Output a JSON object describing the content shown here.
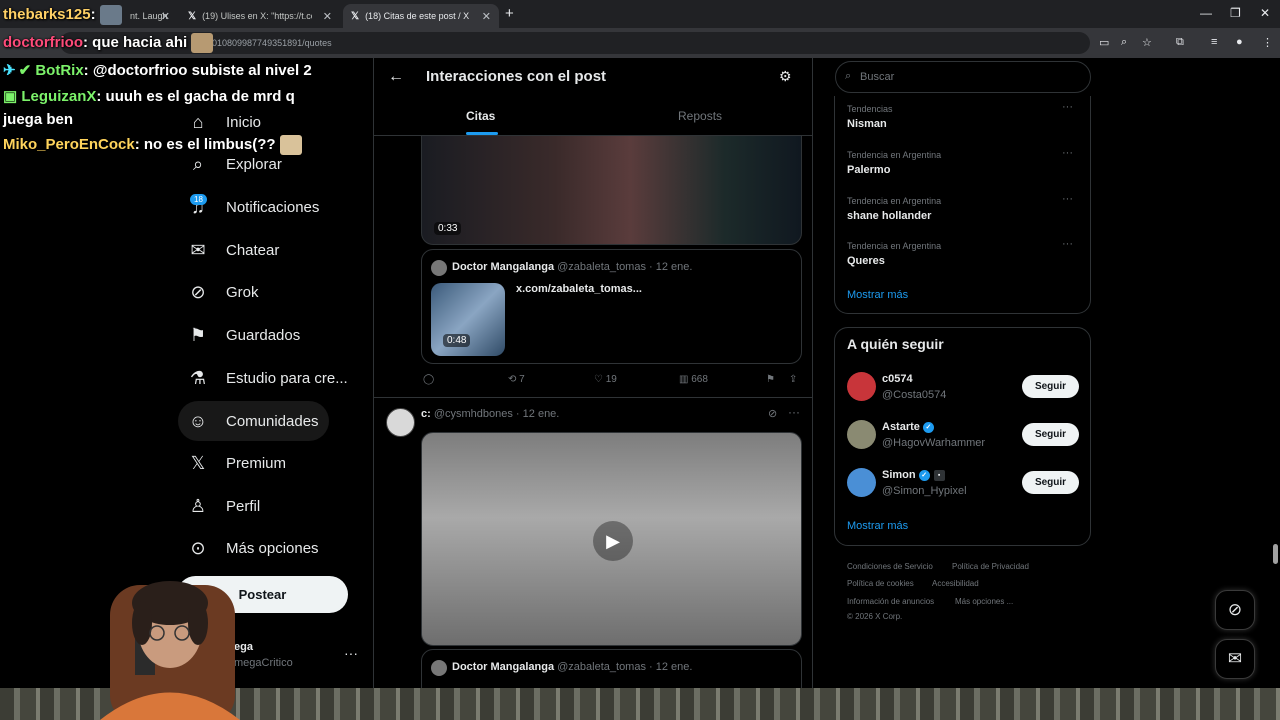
{
  "browser": {
    "tabs": [
      {
        "title": "nt. Laugh"
      },
      {
        "title": "(19) Ulises en X: \"https://t.co/LI"
      },
      {
        "title": "(18) Citas de este post / X"
      }
    ],
    "url": "s/2010809987749351891/quotes"
  },
  "stream_chat": [
    {
      "user": "thebarks125",
      "message": ":",
      "color": "#ffd166"
    },
    {
      "user": "doctorfrioo",
      "message": ": que hacia ahi",
      "color": "#ff4b7a"
    },
    {
      "user": "BotRix",
      "message": ": @doctorfrioo subiste al nivel 2",
      "color": "#7cf26a"
    },
    {
      "user": "LeguizanX",
      "message_line1": ": uuuh es el gacha de mrd q",
      "message_line2": "juega ben",
      "color": "#4be3ff"
    },
    {
      "user": "Miko_PeroEnCock",
      "message": ": no es el limbus(??",
      "color": "#ffd45c"
    }
  ],
  "nav": {
    "items": [
      {
        "label": "Inicio",
        "icon": "home-icon"
      },
      {
        "label": "Explorar",
        "icon": "search-icon"
      },
      {
        "label": "Notificaciones",
        "icon": "bell-icon",
        "badge": "18"
      },
      {
        "label": "Chatear",
        "icon": "mail-icon"
      },
      {
        "label": "Grok",
        "icon": "grok-icon"
      },
      {
        "label": "Guardados",
        "icon": "bookmark-icon"
      },
      {
        "label": "Estudio para cre...",
        "icon": "flask-icon"
      },
      {
        "label": "Comunidades",
        "icon": "people-icon"
      },
      {
        "label": "Premium",
        "icon": "x-logo-icon"
      },
      {
        "label": "Perfil",
        "icon": "person-icon"
      },
      {
        "label": "Más opciones",
        "icon": "more-circle-icon"
      }
    ],
    "post_button": "Postear",
    "account_name": "ega",
    "account_handle": "megaCritico"
  },
  "center": {
    "title": "Interacciones con el post",
    "tabs": [
      "Citas",
      "Reposts"
    ],
    "post1": {
      "video_time": "0:33",
      "quote_name": "Doctor Mangalanga",
      "quote_handle": "@zabaleta_tomas · 12 ene.",
      "quote_link": "x.com/zabaleta_tomas...",
      "quote_video_time": "0:48",
      "retweets": "7",
      "likes": "19",
      "views": "668"
    },
    "post2": {
      "name": "c:",
      "handle": "@cysmhdbones · 12 ene.",
      "quote_name": "Doctor Mangalanga",
      "quote_handle": "@zabaleta_tomas · 12 ene."
    }
  },
  "right": {
    "search_placeholder": "Buscar",
    "trends": [
      {
        "meta": "Tendencias",
        "name": "Nisman"
      },
      {
        "meta": "Tendencia en Argentina",
        "name": "Palermo"
      },
      {
        "meta": "Tendencia en Argentina",
        "name": "shane hollander"
      },
      {
        "meta": "Tendencia en Argentina",
        "name": "Queres"
      }
    ],
    "show_more": "Mostrar más",
    "who_to_follow_title": "A quién seguir",
    "follow_suggestions": [
      {
        "name": "c0574",
        "handle": "@Costa0574",
        "verified": false,
        "avatar_color": "#c8353a"
      },
      {
        "name": "Astarte",
        "handle": "@HagovWarhammer",
        "verified": true,
        "avatar_color": "#8a8a72"
      },
      {
        "name": "Simon",
        "handle": "@Simon_Hypixel",
        "verified": true,
        "avatar_color": "#4a8fd6"
      }
    ],
    "follow_label": "Seguir",
    "footer": {
      "links": [
        "Condiciones de Servicio",
        "Política de Privacidad",
        "Política de cookies",
        "Accesibilidad",
        "Información de anuncios",
        "Más opciones ..."
      ],
      "copyright": "© 2026 X Corp."
    }
  }
}
